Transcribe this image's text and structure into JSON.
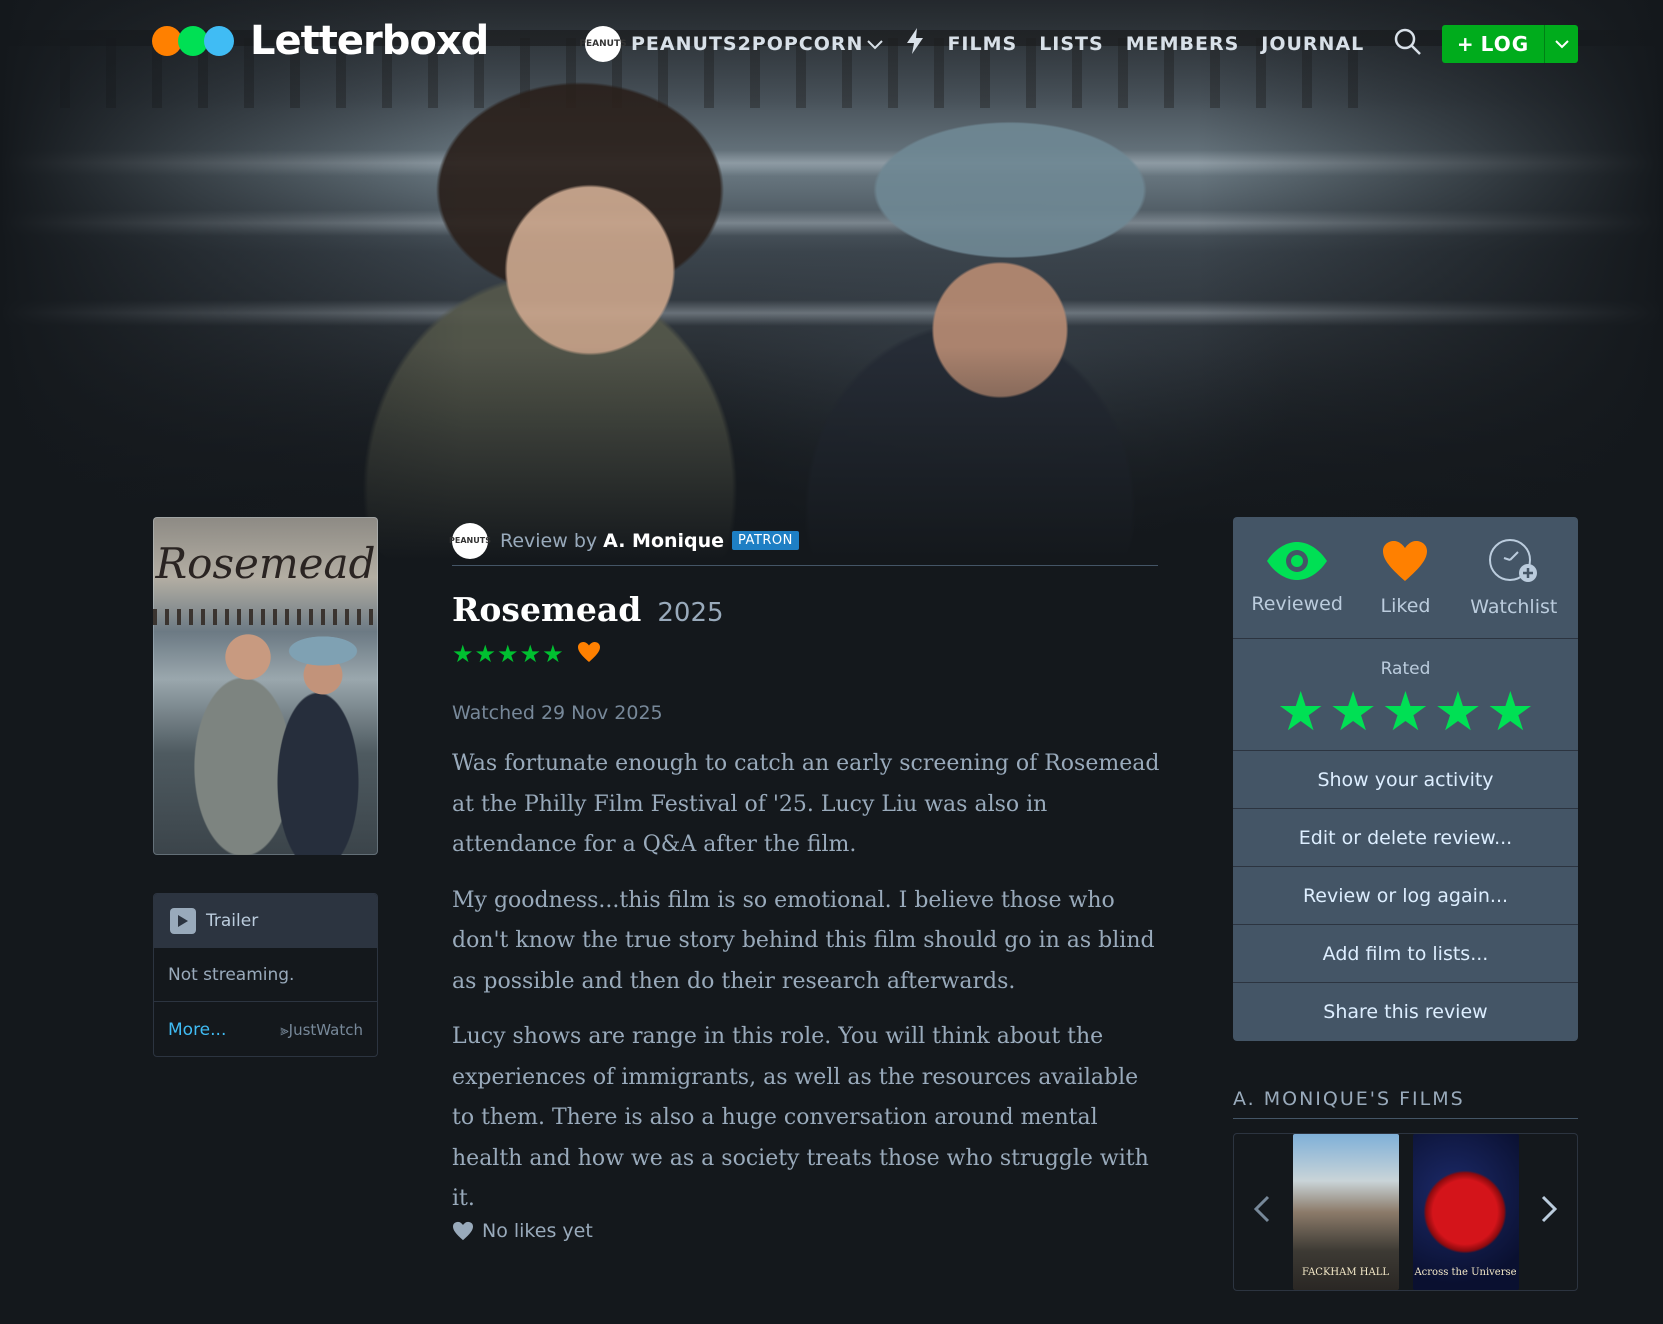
{
  "header": {
    "logo_text": "Letterboxd",
    "username": "PEANUTS2POPCORN",
    "avatar_text": "PEANUTS",
    "nav": [
      "FILMS",
      "LISTS",
      "MEMBERS",
      "JOURNAL"
    ],
    "log_label": "LOG"
  },
  "colors": {
    "accent_green": "#00e054",
    "accent_orange": "#ff8000",
    "accent_blue": "#40bcf4",
    "log_button": "#00ac1c",
    "background": "#14181c"
  },
  "poster": {
    "title": "Rosemead"
  },
  "watch": {
    "trailer_label": "Trailer",
    "streaming_status": "Not streaming.",
    "more_link": "More...",
    "provider": "JustWatch"
  },
  "review": {
    "by_prefix": "Review by",
    "author": "A. Monique",
    "badge": "PATRON",
    "film_title": "Rosemead",
    "year": "2025",
    "rating_stars": 5,
    "liked": true,
    "watched": "Watched 29 Nov 2025",
    "paragraphs": [
      "Was fortunate enough to catch an early screening of Rosemead at the Philly Film Festival of '25. Lucy Liu was also in attendance for a Q&A after the film.",
      "My goodness...this film is so emotional. I believe those who don't know the true story behind this film should go in as blind as possible and then do their research afterwards.",
      "Lucy shows are range in this role. You will think about the experiences of immigrants, as well as the resources available to them. There is also a huge conversation around mental health and how we as a society treats those who struggle with it."
    ],
    "likes_text": "No likes yet"
  },
  "sidebar": {
    "actions": [
      {
        "label": "Reviewed",
        "icon": "eye-icon"
      },
      {
        "label": "Liked",
        "icon": "heart-icon"
      },
      {
        "label": "Watchlist",
        "icon": "watchlist-clock-icon"
      }
    ],
    "rated_label": "Rated",
    "rated_stars": 5,
    "links": [
      "Show your activity",
      "Edit or delete review...",
      "Review or log again...",
      "Add film to lists...",
      "Share this review"
    ],
    "films_title": "A. MONIQUE'S FILMS",
    "films": [
      {
        "title": "FACKHAM HALL"
      },
      {
        "title": "Across the Universe"
      }
    ]
  }
}
